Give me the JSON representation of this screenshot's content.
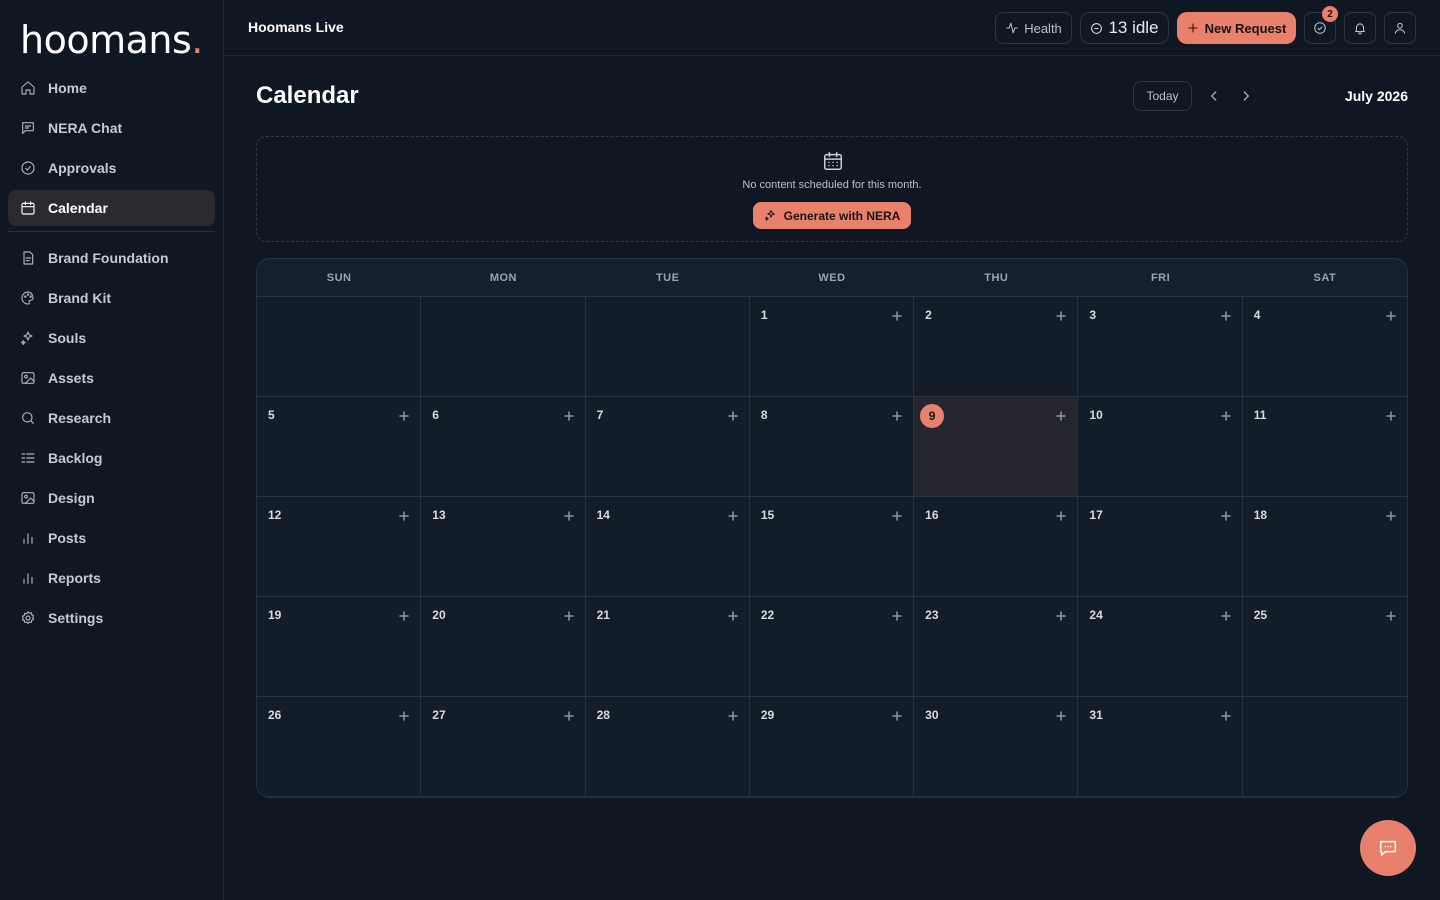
{
  "brand": {
    "logo_text": "hoomans",
    "logo_dot": "."
  },
  "sidebar": {
    "items": [
      {
        "label": "Home",
        "icon": "home-icon"
      },
      {
        "label": "NERA Chat",
        "icon": "chat-icon"
      },
      {
        "label": "Approvals",
        "icon": "check-circle-icon"
      },
      {
        "label": "Calendar",
        "icon": "calendar-icon",
        "active": true
      }
    ],
    "items2": [
      {
        "label": "Brand Foundation",
        "icon": "document-icon"
      },
      {
        "label": "Brand Kit",
        "icon": "palette-icon"
      },
      {
        "label": "Souls",
        "icon": "sparkles-icon"
      },
      {
        "label": "Assets",
        "icon": "image-icon"
      },
      {
        "label": "Research",
        "icon": "search-icon"
      },
      {
        "label": "Backlog",
        "icon": "list-icon"
      },
      {
        "label": "Design",
        "icon": "image-icon"
      },
      {
        "label": "Posts",
        "icon": "bar-chart-icon"
      },
      {
        "label": "Reports",
        "icon": "bar-chart-icon"
      },
      {
        "label": "Settings",
        "icon": "gear-icon"
      }
    ]
  },
  "topbar": {
    "title": "Hoomans Live",
    "health_label": "Health",
    "idle_label": "13 idle",
    "new_request_label": "New Request",
    "approvals_badge": "2"
  },
  "calendar": {
    "title": "Calendar",
    "today_label": "Today",
    "month_label": "July 2026",
    "empty_text": "No content scheduled for this month.",
    "generate_label": "Generate with NERA",
    "weekdays": [
      "SUN",
      "MON",
      "TUE",
      "WED",
      "THU",
      "FRI",
      "SAT"
    ],
    "leading_blanks": 3,
    "days_in_month": 31,
    "today": 9
  },
  "colors": {
    "accent": "#e8806c",
    "background": "#0f1722"
  }
}
